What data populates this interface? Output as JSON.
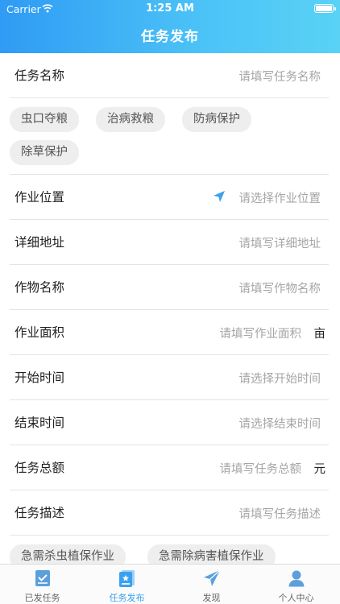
{
  "status_bar": {
    "carrier": "Carrier",
    "time": "1:25 AM"
  },
  "header": {
    "title": "任务发布"
  },
  "form": {
    "task_name": {
      "label": "任务名称",
      "placeholder": "请填写任务名称"
    },
    "location": {
      "label": "作业位置",
      "placeholder": "请选择作业位置"
    },
    "address": {
      "label": "详细地址",
      "placeholder": "请填写详细地址"
    },
    "crop": {
      "label": "作物名称",
      "placeholder": "请填写作物名称"
    },
    "area": {
      "label": "作业面积",
      "placeholder": "请填写作业面积",
      "unit": "亩"
    },
    "start_time": {
      "label": "开始时间",
      "placeholder": "请选择开始时间"
    },
    "end_time": {
      "label": "结束时间",
      "placeholder": "请选择结束时间"
    },
    "amount": {
      "label": "任务总额",
      "placeholder": "请填写任务总额",
      "unit": "元"
    },
    "description": {
      "label": "任务描述",
      "placeholder": "请填写任务描述"
    }
  },
  "name_tags": [
    "虫口夺粮",
    "治病救粮",
    "防病保护",
    "除草保护"
  ],
  "desc_tags": [
    "急需杀虫植保作业",
    "急需除病害植保作业"
  ],
  "tabbar": {
    "tabs": [
      {
        "label": "已发任务",
        "icon": "published-tasks-icon"
      },
      {
        "label": "任务发布",
        "icon": "publish-task-icon"
      },
      {
        "label": "发现",
        "icon": "discover-icon"
      },
      {
        "label": "个人中心",
        "icon": "profile-icon"
      }
    ],
    "active_index": 1
  },
  "colors": {
    "accent": "#3aa0f0",
    "header_start": "#2f9bf4",
    "header_end": "#59d2f6",
    "placeholder": "#a5a5a5",
    "tag_bg": "#eeeeee"
  }
}
